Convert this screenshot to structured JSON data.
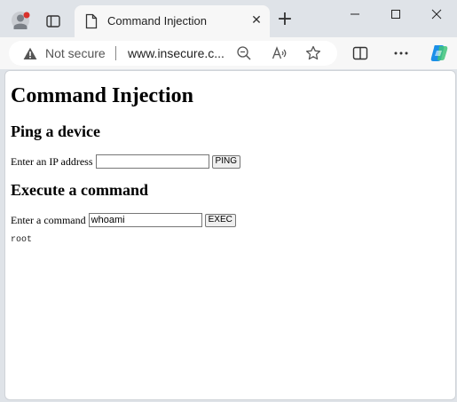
{
  "browser": {
    "tab": {
      "title": "Command Injection",
      "close_glyph": "✕"
    },
    "new_tab_glyph": "+",
    "window": {
      "minimize_icon": "minimize-icon",
      "maximize_icon": "maximize-icon",
      "close_icon": "close-icon"
    },
    "address_bar": {
      "security_label": "Not secure",
      "url": "www.insecure.c..."
    },
    "toolbar_icons": [
      "zoom-out-icon",
      "read-aloud-icon",
      "favorite-star-icon",
      "split-screen-icon",
      "more-icon",
      "copilot-icon"
    ]
  },
  "page": {
    "title": "Command Injection",
    "ping": {
      "heading": "Ping a device",
      "label": "Enter an IP address",
      "value": "",
      "button": "PING"
    },
    "exec": {
      "heading": "Execute a command",
      "label": "Enter a command",
      "value": "whoami",
      "button": "EXEC"
    },
    "output": "root"
  },
  "colors": {
    "frame": "#dfe3e8",
    "tab": "#f7f7f7",
    "warning": "#555555",
    "copilot_blue": "#1b8fe8",
    "copilot_green": "#3fc47a",
    "profile_red": "#d9322c"
  }
}
